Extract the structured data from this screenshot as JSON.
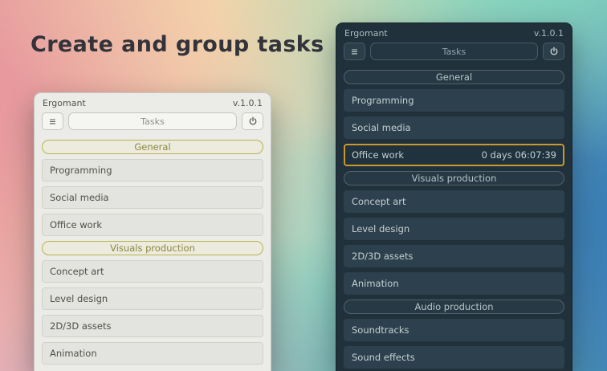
{
  "page": {
    "heading": "Create and group tasks"
  },
  "colors": {
    "active_task_border": "#c9992f",
    "group_outline_light": "#b7b44d"
  },
  "windows": [
    {
      "name": "light-theme-window",
      "title": "Ergomant",
      "version": "v.1.0.1",
      "toolbar": {
        "menu_icon": "hamburger-icon",
        "tasks_label": "Tasks",
        "power_icon": "power-icon"
      },
      "items": [
        {
          "type": "group",
          "label": "General"
        },
        {
          "type": "task",
          "label": "Programming"
        },
        {
          "type": "task",
          "label": "Social media"
        },
        {
          "type": "task",
          "label": "Office work"
        },
        {
          "type": "group",
          "label": "Visuals production"
        },
        {
          "type": "task",
          "label": "Concept art"
        },
        {
          "type": "task",
          "label": "Level design"
        },
        {
          "type": "task",
          "label": "2D/3D assets"
        },
        {
          "type": "task",
          "label": "Animation"
        }
      ]
    },
    {
      "name": "dark-theme-window",
      "title": "Ergomant",
      "version": "v.1.0.1",
      "toolbar": {
        "menu_icon": "hamburger-icon",
        "tasks_label": "Tasks",
        "power_icon": "power-icon"
      },
      "items": [
        {
          "type": "group",
          "label": "General"
        },
        {
          "type": "task",
          "label": "Programming"
        },
        {
          "type": "task",
          "label": "Social media"
        },
        {
          "type": "task",
          "label": "Office work",
          "timer": "0 days 06:07:39",
          "active": true
        },
        {
          "type": "group",
          "label": "Visuals production"
        },
        {
          "type": "task",
          "label": "Concept art"
        },
        {
          "type": "task",
          "label": "Level design"
        },
        {
          "type": "task",
          "label": "2D/3D assets"
        },
        {
          "type": "task",
          "label": "Animation"
        },
        {
          "type": "group",
          "label": "Audio production"
        },
        {
          "type": "task",
          "label": "Soundtracks"
        },
        {
          "type": "task",
          "label": "Sound effects"
        }
      ]
    }
  ]
}
